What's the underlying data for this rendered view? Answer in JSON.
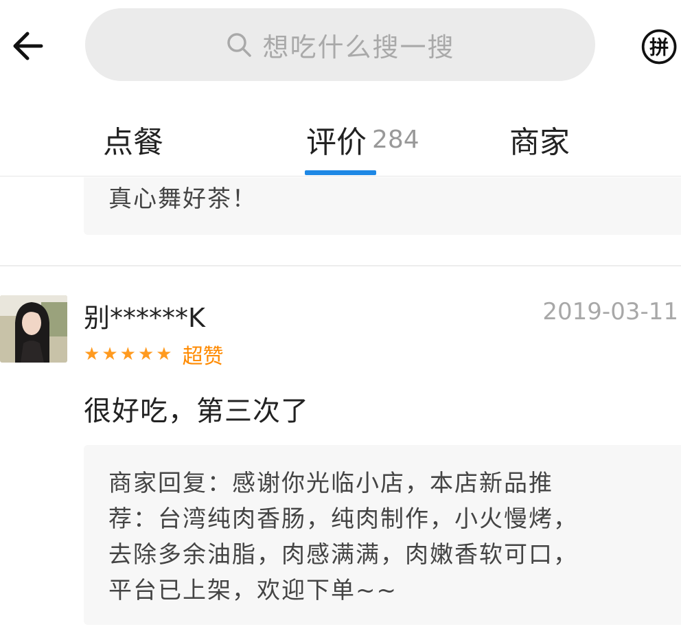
{
  "header": {
    "back_icon": "arrow-left-icon",
    "search": {
      "icon": "search-icon",
      "placeholder": "想吃什么搜一搜"
    },
    "group_order_icon": "pin-group-icon",
    "group_order_glyph": "拼"
  },
  "tabs": [
    {
      "label": "点餐"
    },
    {
      "label": "评价",
      "count": "284",
      "active": true
    },
    {
      "label": "商家"
    }
  ],
  "colors": {
    "accent": "#1e88e5",
    "star": "#ff9a1f",
    "rating_label": "#ff8a00",
    "date_text": "#a8a8a8",
    "reply_background": "#f7f7f7"
  },
  "previous_review": {
    "reply_tail": "真心舞好茶！"
  },
  "review": {
    "username": "别******K",
    "date": "2019-03-11",
    "rating": 5,
    "rating_label": "超赞",
    "text": "很好吃，第三次了",
    "merchant_reply_lines": [
      "商家回复：感谢你光临小店，本店新品推",
      "荐：台湾纯肉香肠，纯肉制作，小火慢烤，",
      "去除多余油脂，肉感满满，肉嫩香软可口，",
      "平台已上架，欢迎下单~~"
    ]
  }
}
